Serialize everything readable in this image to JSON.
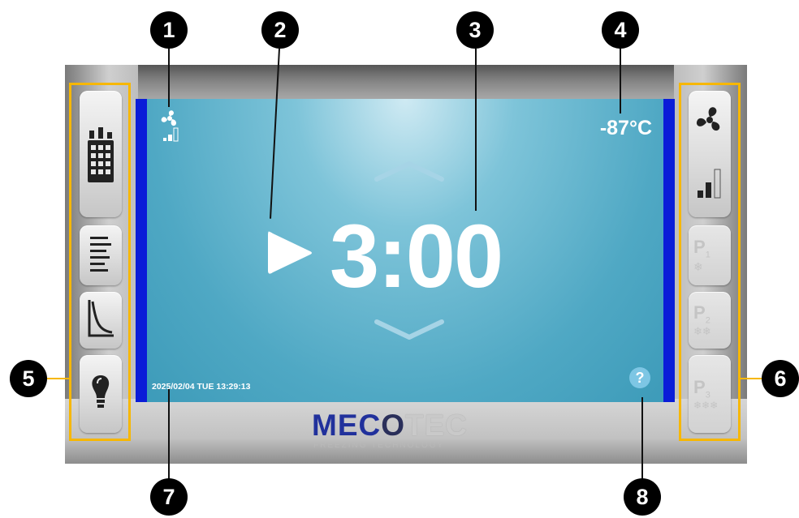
{
  "markers": [
    "1",
    "2",
    "3",
    "4",
    "5",
    "6",
    "7",
    "8"
  ],
  "screen": {
    "timer_text": "3:00",
    "temperature": "-87°C",
    "datetime": "2025/02/04 TUE 13:29:13",
    "help_symbol": "?"
  },
  "logo": {
    "part1": "MEC",
    "part2": "O",
    "part3": "TEC",
    "tagline": "FREEZING TECHNOLOGY"
  },
  "right_panel": {
    "presets": [
      {
        "letter": "P",
        "index": "1"
      },
      {
        "letter": "P",
        "index": "2"
      },
      {
        "letter": "P",
        "index": "3"
      }
    ]
  },
  "icons": {
    "left": [
      "calendar-icon",
      "list-icon",
      "graph-icon",
      "bulb-icon"
    ],
    "right": [
      "fan-icon",
      "signal-level-icon"
    ],
    "status": "fan-status-icon",
    "play": "play-icon",
    "up": "chevron-up-icon",
    "down": "chevron-down-icon"
  },
  "colors": {
    "accent_yellow": "#f7b700",
    "screen_blue": "#4fa8c4",
    "side_blue": "#0a1cd8",
    "marker_black": "#000000"
  }
}
